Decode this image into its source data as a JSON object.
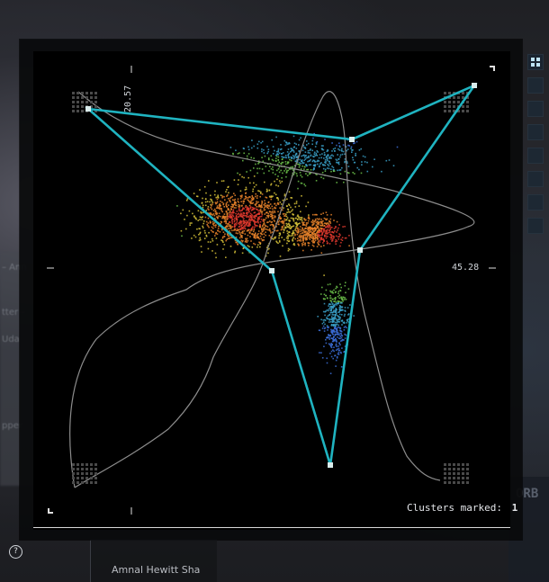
{
  "background": {
    "char_name": "Amnal Hewitt Sha",
    "side_logo_text": "ORB"
  },
  "plot": {
    "marker_vertical_value": "20.57",
    "marker_horizontal_value": "45.28",
    "status_label": "Clusters marked:",
    "status_count": "1"
  },
  "sidebar": {
    "buttons": [
      "grid-view",
      "slot-1",
      "slot-2",
      "slot-3",
      "slot-4",
      "slot-5",
      "slot-6",
      "slot-7"
    ]
  },
  "help": {
    "label": "?"
  },
  "colors": {
    "polygon": "#1fb3c0",
    "vertex": "#d9ecec",
    "curve": "#8c8c8c",
    "accent": "#bfe4f5"
  }
}
